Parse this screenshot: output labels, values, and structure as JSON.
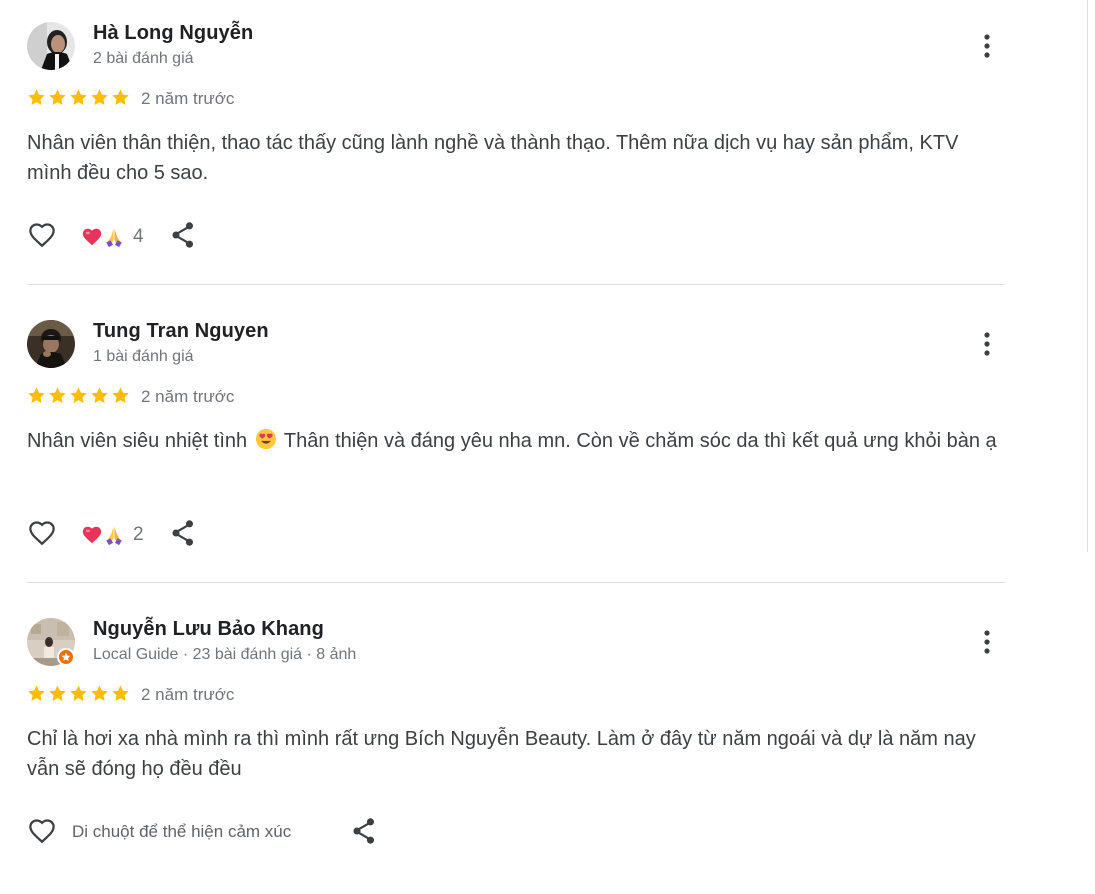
{
  "reviews": [
    {
      "name": "Hà Long Nguyễn",
      "meta": "2 bài đánh giá",
      "rating": 5,
      "time": "2 năm trước",
      "text": "Nhân viên thân thiện, thao tác thấy cũng lành nghề và thành thạo. Thêm nữa dịch vụ hay sản phẩm, KTV mình đều cho 5 sao.",
      "reaction_count": "4"
    },
    {
      "name": "Tung Tran Nguyen",
      "meta": "1 bài đánh giá",
      "rating": 5,
      "time": "2 năm trước",
      "text_before": "Nhân viên siêu nhiệt tình",
      "text_emoji": "smiling-face-with-heart-eyes-icon",
      "text_after": "Thân thiện và đáng yêu nha mn. Còn về chăm sóc da thì kết quả ưng khỏi bàn ạ",
      "reaction_count": "2"
    },
    {
      "name": "Nguyễn Lưu Bảo Khang",
      "meta": "Local Guide · 23 bài đánh giá · 8 ảnh",
      "rating": 5,
      "time": "2 năm trước",
      "text": "Chỉ là hơi xa nhà mình ra thì mình rất ưng Bích Nguyễn Beauty. Làm ở đây từ năm ngoái và dự là năm nay vẫn sẽ đóng họ đều đều",
      "hover_hint": "Di chuột để thể hiện cảm xúc"
    }
  ],
  "icons": {
    "more": "more-vertical-icon",
    "like": "heart-outline-icon",
    "share": "share-icon",
    "reaction_heart": "heart-reaction-icon",
    "reaction_pray": "folded-hands-reaction-icon",
    "local_guide_badge": "star-badge-icon"
  },
  "colors": {
    "star": "#fbbc04",
    "name": "#202124",
    "meta": "#70757a",
    "body": "#3c4043",
    "icon": "#3c4043",
    "divider": "#dadce0",
    "local_guide_badge": "#e8710a"
  }
}
